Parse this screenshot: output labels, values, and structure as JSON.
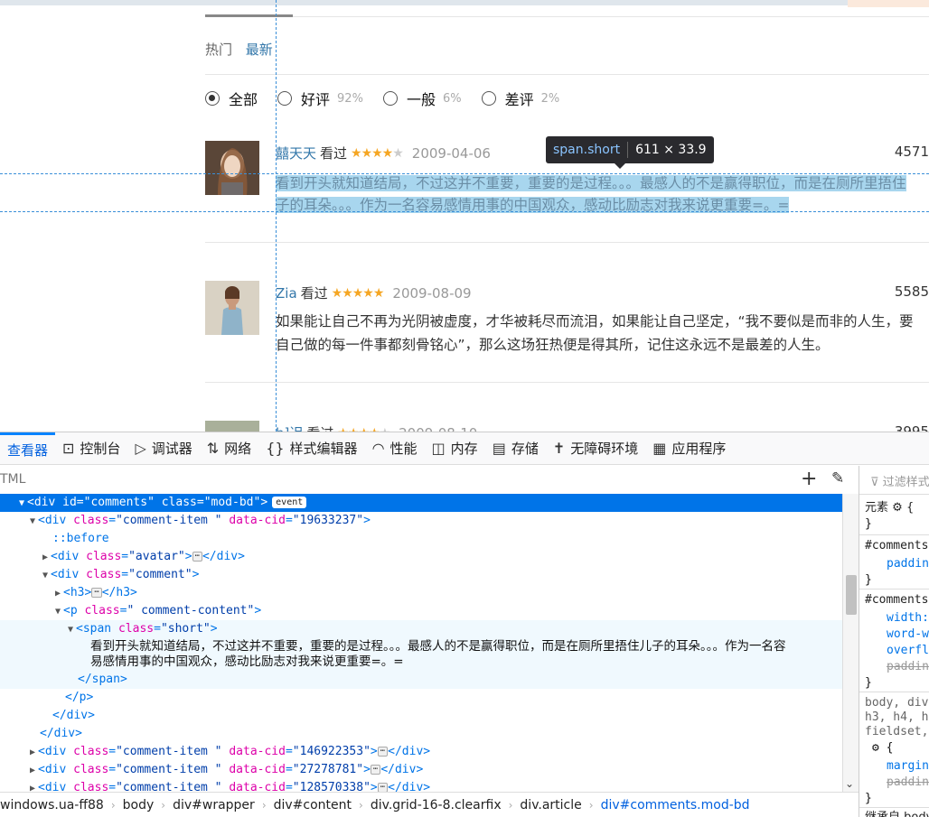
{
  "page": {
    "sort_tabs": [
      "热门",
      "最新"
    ],
    "filters": [
      {
        "label": "全部",
        "pct": "",
        "checked": true
      },
      {
        "label": "好评",
        "pct": "92%",
        "checked": false
      },
      {
        "label": "一般",
        "pct": "6%",
        "checked": false
      },
      {
        "label": "差评",
        "pct": "2%",
        "checked": false
      }
    ],
    "comments": [
      {
        "user": "囍天天",
        "status": "看过",
        "rating": 4,
        "date": "2009-04-06",
        "votes": "4571",
        "text_line1": "看到开头就知道结局，不过这并不重要，重要的是过程。。。最感人的不是赢得职位，而是在厕所里捂住",
        "text_line2": "子的耳朵。。。作为一名容易感情用事的中国观众，感动比励志对我来说更重要=。="
      },
      {
        "user": "Zia",
        "status": "看过",
        "rating": 5,
        "date": "2009-08-09",
        "votes": "5585",
        "text_line1": "如果能让自己不再为光阴被虚度，才华被耗尽而流泪，如果能让自己坚定，“我不要似是而非的人生，要",
        "text_line2": "自己做的每一件事都刻骨铭心”，那么这场狂热便是得其所，记住这永远不是最差的人生。"
      },
      {
        "user": "h]迟",
        "status": "看过",
        "rating": 4,
        "date": "2009-08-10",
        "votes": "3995"
      }
    ],
    "tooltip": {
      "selector": "span.short",
      "size": "611 × 33.9"
    }
  },
  "devtools": {
    "tabs": [
      {
        "icon": "inspector-icon",
        "label": "查看器",
        "glyph": "▢"
      },
      {
        "icon": "console-icon",
        "label": "控制台",
        "glyph": "⊡"
      },
      {
        "icon": "debugger-icon",
        "label": "调试器",
        "glyph": "▷"
      },
      {
        "icon": "network-icon",
        "label": "网络",
        "glyph": "⇅"
      },
      {
        "icon": "style-editor-icon",
        "label": "样式编辑器",
        "glyph": "{}"
      },
      {
        "icon": "performance-icon",
        "label": "性能",
        "glyph": "◠"
      },
      {
        "icon": "memory-icon",
        "label": "内存",
        "glyph": "◫"
      },
      {
        "icon": "storage-icon",
        "label": "存储",
        "glyph": "▤"
      },
      {
        "icon": "accessibility-icon",
        "label": "无障碍环境",
        "glyph": "✝"
      },
      {
        "icon": "application-icon",
        "label": "应用程序",
        "glyph": "▦"
      }
    ],
    "search_placeholder": "TML",
    "tree": {
      "r0_tag": "div",
      "r0_a1": "id",
      "r0_v1": "\"comments\"",
      "r0_a2": "class",
      "r0_v2": "\"mod-bd\"",
      "r0_badge": "event",
      "r1_tag": "div",
      "r1_a1": "class",
      "r1_v1": "\"comment-item \"",
      "r1_a2": "data-cid",
      "r1_v2": "\"19633237\"",
      "r2_pseudo": "::before",
      "r3_tag": "div",
      "r3_a1": "class",
      "r3_v1": "\"avatar\"",
      "r4_tag": "div",
      "r4_a1": "class",
      "r4_v1": "\"comment\"",
      "r5_tag": "h3",
      "r6_tag": "p",
      "r6_a1": "class",
      "r6_v1": "\" comment-content\"",
      "r7_tag": "span",
      "r7_a1": "class",
      "r7_v1": "\"short\"",
      "r8_text": "看到开头就知道结局，不过这并不重要，重要的是过程。。。最感人的不是赢得职位，而是在厕所里捂住儿子的耳朵。。。作为一名容",
      "r9_text": "易感情用事的中国观众，感动比励志对我来说更重要=。=",
      "r10_close": "</span>",
      "r11_close": "</p>",
      "r12_close": "</div>",
      "r13_close": "</div>",
      "r14_tag": "div",
      "r14_a1": "class",
      "r14_v1": "\"comment-item \"",
      "r14_a2": "data-cid",
      "r14_v2": "\"146922353\"",
      "r15_tag": "div",
      "r15_a1": "class",
      "r15_v1": "\"comment-item \"",
      "r15_a2": "data-cid",
      "r15_v2": "\"27278781\"",
      "r16_tag": "div",
      "r16_a1": "class",
      "r16_v1": "\"comment-item \"",
      "r16_a2": "data-cid",
      "r16_v2": "\"128570338\""
    },
    "breadcrumb": [
      "windows.ua-ff88",
      "body",
      "div#wrapper",
      "div#content",
      "div.grid-16-8.clearfix",
      "div.article",
      "div#comments.mod-bd"
    ],
    "rules": {
      "filter_placeholder": "过滤样式",
      "element_label": "元素",
      "brace_open": "{",
      "brace_close": "}",
      "sel1": "#comments",
      "p_padding": "padding",
      "sel2": "#comments",
      "p_width": "width:",
      "p_wordwrap": "word-w",
      "p_overflow": "overfl",
      "p_padding2": "paddin",
      "ua_sel1": "body, div",
      "ua_sel2": "h3, h4, h",
      "ua_sel3": "fieldset,",
      "p_margin": "margin",
      "p_padding3": "paddin",
      "inherited": "继承自 body"
    }
  }
}
